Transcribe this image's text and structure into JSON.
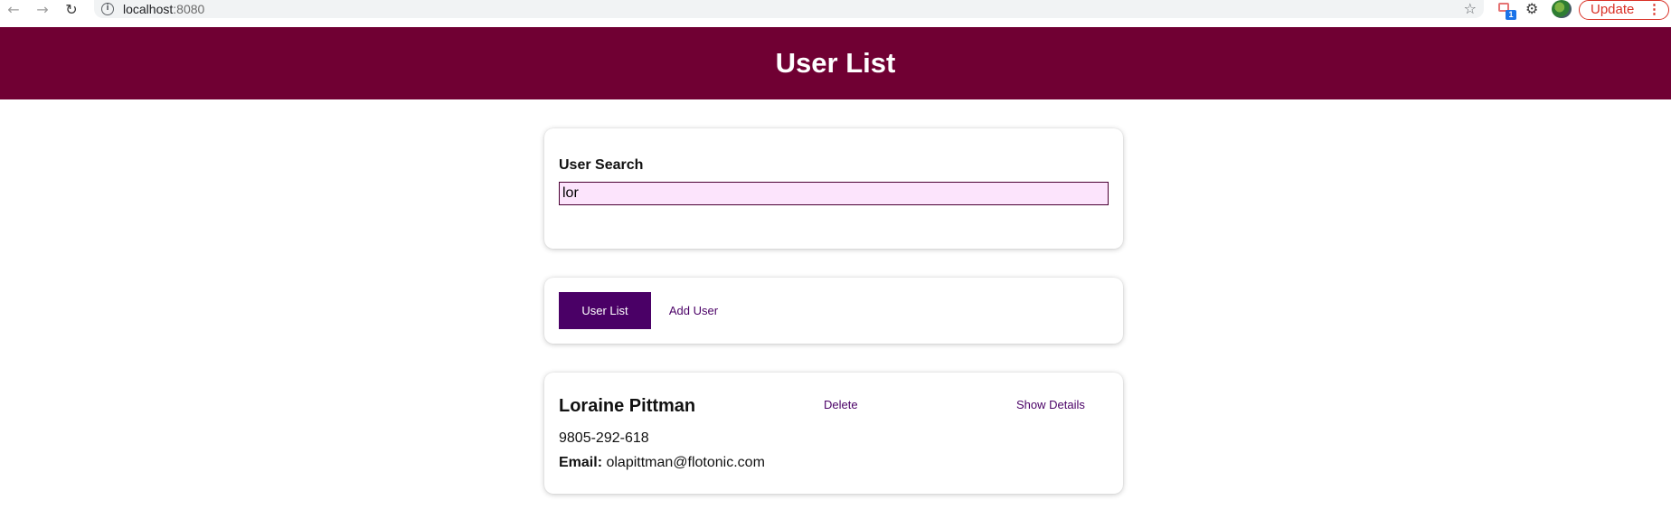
{
  "browser": {
    "url_host": "localhost",
    "url_port": ":8080",
    "update_label": "Update",
    "extension_badge": "1",
    "icons": [
      "back-arrow-icon",
      "forward-arrow-icon",
      "reload-icon",
      "info-icon",
      "star-icon",
      "extension-icon",
      "puzzle-icon",
      "avatar",
      "more-icon"
    ]
  },
  "header": {
    "title": "User List",
    "background": "#700033"
  },
  "search": {
    "label": "User Search",
    "value": "lor"
  },
  "tabs": [
    {
      "label": "User List",
      "active": true
    },
    {
      "label": "Add User",
      "active": false
    }
  ],
  "users": [
    {
      "name": "Loraine Pittman",
      "delete_label": "Delete",
      "details_label": "Show Details",
      "phone": "9805-292-618",
      "email_label": "Email:",
      "email": "olapittman@flotonic.com"
    }
  ],
  "colors": {
    "accent": "#4a0066",
    "input_bg": "#fce4fc"
  }
}
